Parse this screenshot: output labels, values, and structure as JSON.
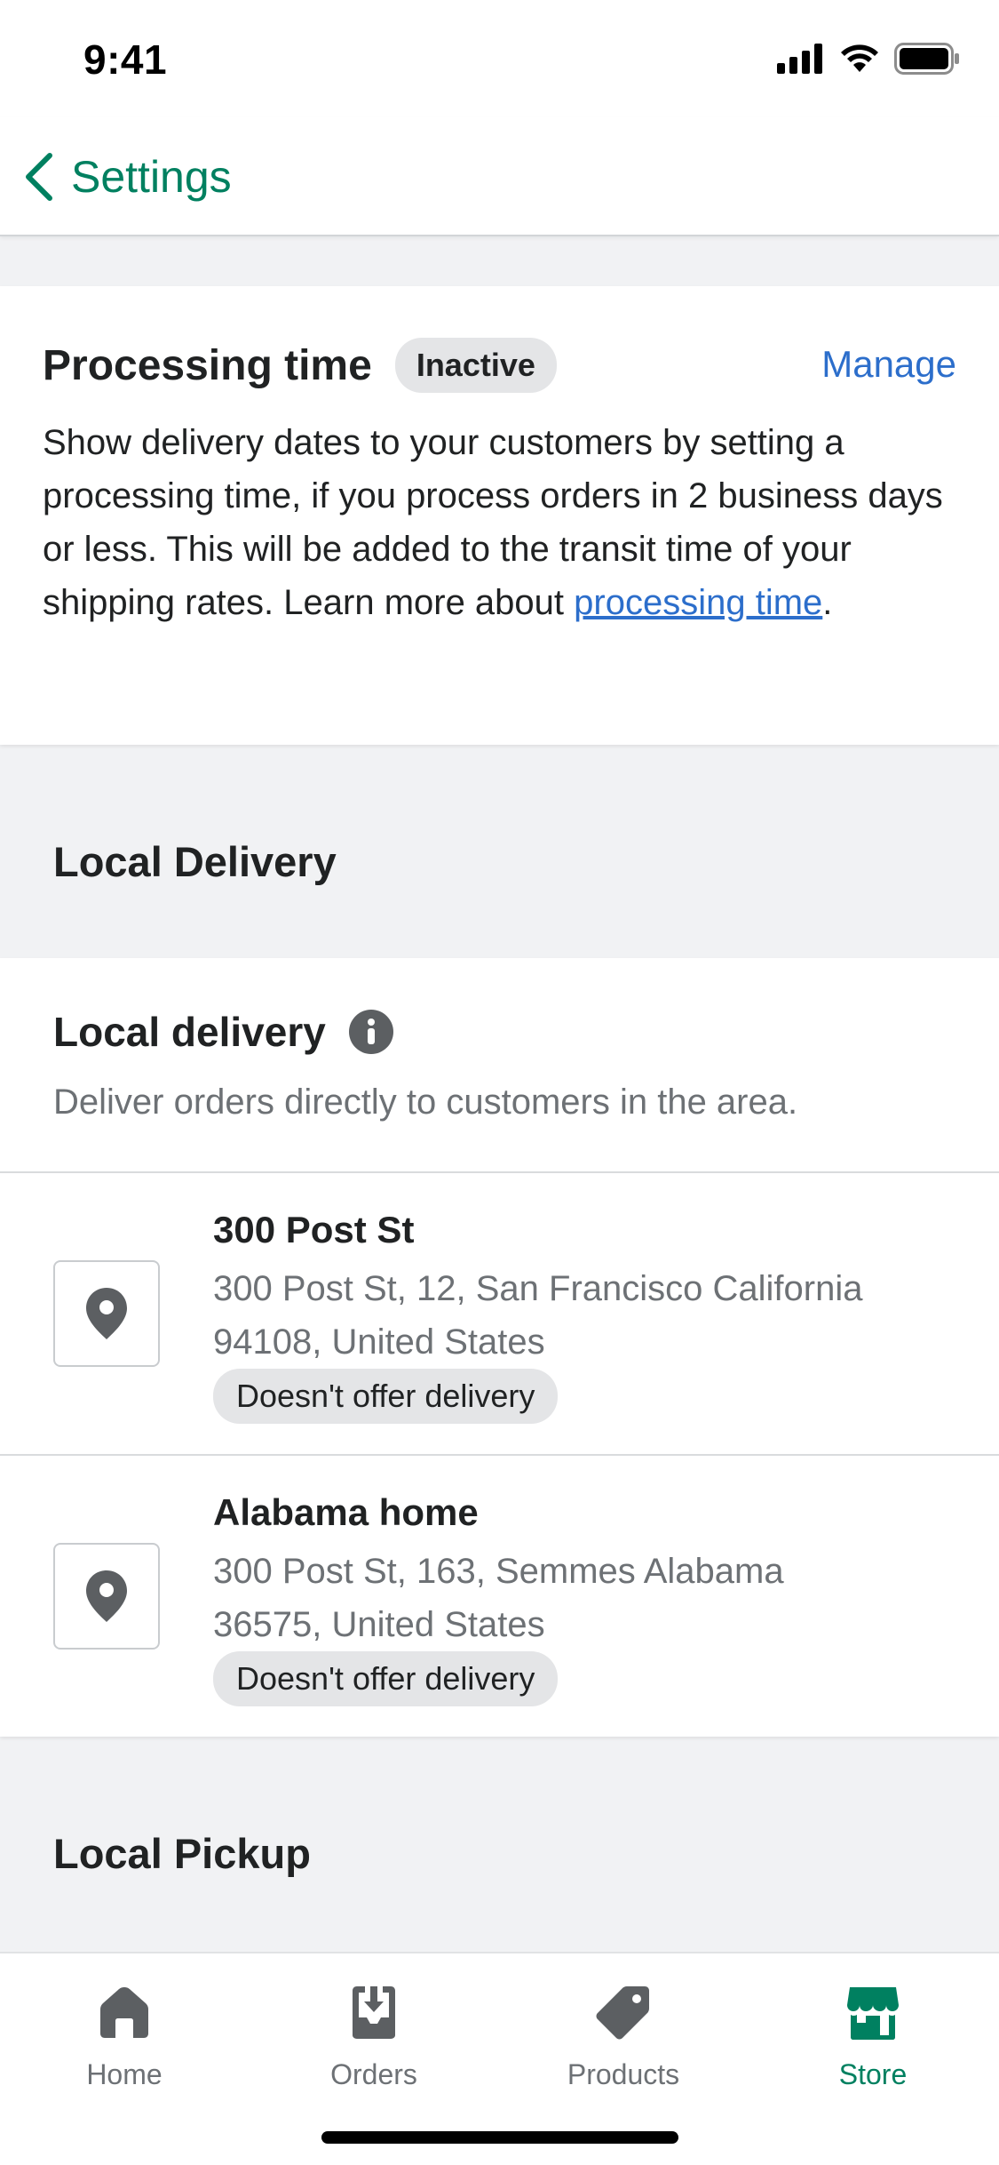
{
  "status_bar": {
    "time": "9:41"
  },
  "nav": {
    "back_label": "Settings"
  },
  "processing": {
    "title": "Processing time",
    "badge": "Inactive",
    "manage_label": "Manage",
    "description": "Show delivery dates to your customers by setting a processing time, if you process orders in 2 business days or less. This will be added to the transit time of your shipping rates. Learn more about ",
    "link_text": "processing time",
    "trailing": "."
  },
  "sections": {
    "local_delivery_header": "Local Delivery",
    "local_pickup_header": "Local Pickup"
  },
  "local_delivery": {
    "title": "Local delivery",
    "description": "Deliver orders directly to customers in the area.",
    "locations": [
      {
        "name": "300 Post St",
        "address_line1": "300 Post St, 12, San Francisco California",
        "address_line2": "94108, United States",
        "status": "Doesn't offer delivery"
      },
      {
        "name": "Alabama home",
        "address_line1": "300 Post St, 163, Semmes Alabama",
        "address_line2": "36575, United States",
        "status": "Doesn't offer delivery"
      }
    ]
  },
  "tabs": [
    {
      "label": "Home",
      "icon": "home-icon",
      "active": false
    },
    {
      "label": "Orders",
      "icon": "orders-icon",
      "active": false
    },
    {
      "label": "Products",
      "icon": "tag-icon",
      "active": false
    },
    {
      "label": "Store",
      "icon": "store-icon",
      "active": true
    }
  ],
  "colors": {
    "accent_green": "#008060",
    "link_blue": "#2c6ecb",
    "icon_gray": "#5c5f62"
  }
}
